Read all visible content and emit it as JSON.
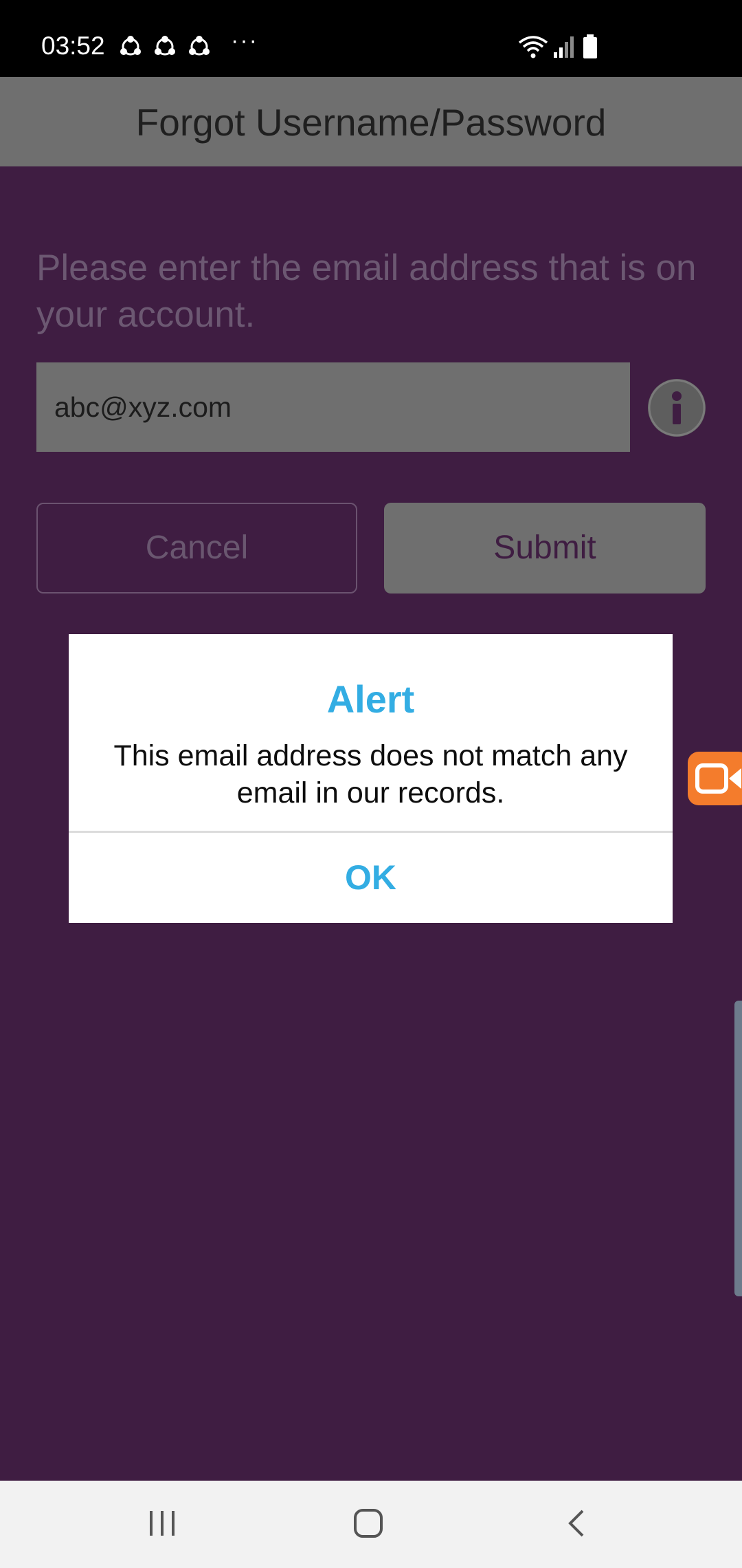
{
  "status_bar": {
    "time": "03:52",
    "more_indicator": "···",
    "notification_icons": [
      "share-icon",
      "share-icon",
      "share-icon"
    ],
    "system_icons": [
      "wifi-icon",
      "signal-icon",
      "battery-icon"
    ]
  },
  "header": {
    "title": "Forgot Username/Password"
  },
  "form": {
    "prompt": "Please enter the email address that is on your account.",
    "email_value": "abc@xyz.com",
    "cancel_label": "Cancel",
    "submit_label": "Submit"
  },
  "dialog": {
    "title": "Alert",
    "message": "This email address does not match any email in our records.",
    "ok_label": "OK"
  },
  "nav_bar": {
    "buttons": [
      "recent-apps-icon",
      "home-icon",
      "back-icon"
    ]
  },
  "colors": {
    "background": "#3f1d42",
    "header": "#6f6f6f",
    "dialog_accent": "#33ade3",
    "recorder": "#f47c2c"
  }
}
